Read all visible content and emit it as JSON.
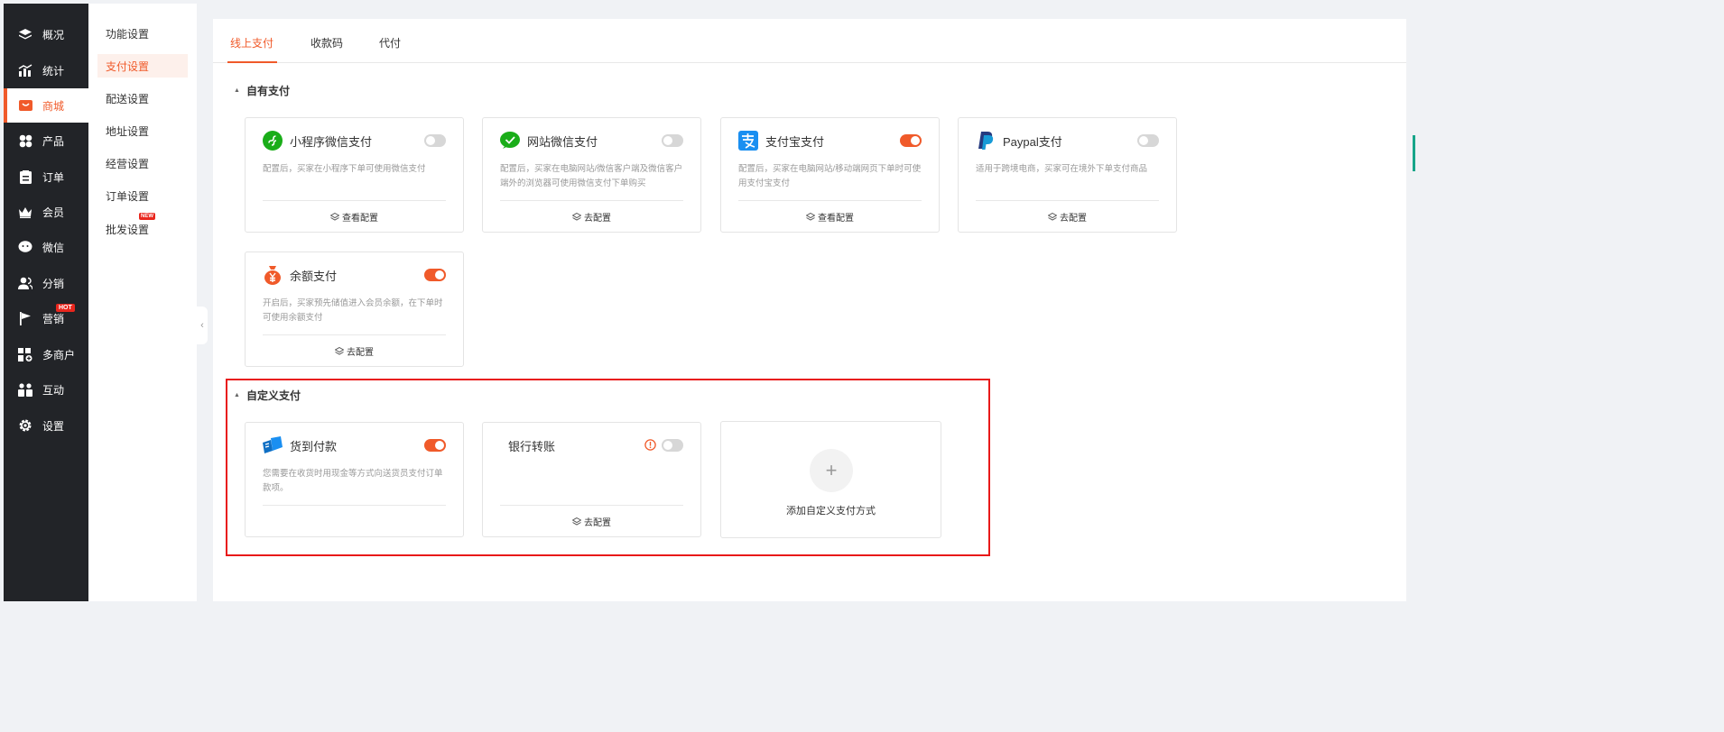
{
  "nav": {
    "items": [
      {
        "label": "概况",
        "icon": "layers-icon"
      },
      {
        "label": "统计",
        "icon": "stats-icon"
      },
      {
        "label": "商城",
        "icon": "mall-icon",
        "active": true
      },
      {
        "label": "产品",
        "icon": "product-icon"
      },
      {
        "label": "订单",
        "icon": "order-icon"
      },
      {
        "label": "会员",
        "icon": "crown-icon"
      },
      {
        "label": "微信",
        "icon": "wechat-icon"
      },
      {
        "label": "分销",
        "icon": "users-icon"
      },
      {
        "label": "营销",
        "icon": "flag-icon",
        "badge": "HOT"
      },
      {
        "label": "多商户",
        "icon": "shop-add-icon"
      },
      {
        "label": "互动",
        "icon": "interaction-icon"
      },
      {
        "label": "设置",
        "icon": "gear-icon"
      }
    ]
  },
  "subnav": {
    "items": [
      {
        "label": "功能设置"
      },
      {
        "label": "支付设置",
        "active": true
      },
      {
        "label": "配送设置"
      },
      {
        "label": "地址设置"
      },
      {
        "label": "经营设置"
      },
      {
        "label": "订单设置"
      },
      {
        "label": "批发设置",
        "badge": "NEW"
      }
    ]
  },
  "tabs": [
    {
      "label": "线上支付",
      "active": true
    },
    {
      "label": "收款码"
    },
    {
      "label": "代付"
    }
  ],
  "sections": {
    "own": {
      "title": "自有支付"
    },
    "custom": {
      "title": "自定义支付"
    }
  },
  "own_payments": [
    {
      "name": "小程序微信支付",
      "icon": "mini-program-icon",
      "enabled": false,
      "desc": "配置后，买家在小程序下单可使用微信支付",
      "action": "查看配置"
    },
    {
      "name": "网站微信支付",
      "icon": "wechat-pay-icon",
      "enabled": false,
      "desc": "配置后，买家在电脑网站/微信客户端及微信客户端外的浏览器可使用微信支付下单购买",
      "action": "去配置"
    },
    {
      "name": "支付宝支付",
      "icon": "alipay-icon",
      "enabled": true,
      "desc": "配置后，买家在电脑网站/移动端网页下单时可使用支付宝支付",
      "action": "查看配置"
    },
    {
      "name": "Paypal支付",
      "icon": "paypal-icon",
      "enabled": false,
      "desc": "适用于跨境电商，买家可在境外下单支付商品",
      "action": "去配置"
    },
    {
      "name": "余额支付",
      "icon": "balance-icon",
      "enabled": true,
      "desc": "开启后，买家预先储值进入会员余额，在下单时可使用余额支付",
      "action": "去配置"
    }
  ],
  "custom_payments": [
    {
      "name": "货到付款",
      "icon": "cod-box-icon",
      "enabled": true,
      "desc": "您需要在收货时用现金等方式向送货员支付订单款项。",
      "action": ""
    },
    {
      "name": "银行转账",
      "icon": "",
      "enabled": false,
      "warning": true,
      "desc": "",
      "action": "去配置"
    }
  ],
  "add_custom": {
    "label": "添加自定义支付方式"
  },
  "colors": {
    "accent": "#f05a2a",
    "nav_bg": "#222428",
    "highlight": "#e81919"
  }
}
